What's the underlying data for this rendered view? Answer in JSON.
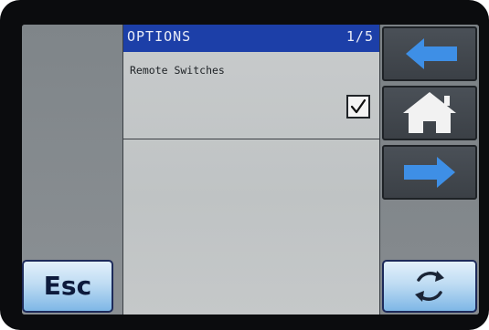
{
  "header": {
    "title": "OPTIONS",
    "page_indicator": "1/5"
  },
  "options": [
    {
      "label": "Remote Switches",
      "checked": true
    }
  ],
  "buttons": {
    "back": {
      "icon": "left-arrow-icon"
    },
    "home": {
      "icon": "home-icon"
    },
    "forward": {
      "icon": "right-arrow-icon"
    },
    "esc": {
      "label": "Esc"
    },
    "refresh": {
      "icon": "refresh-icon"
    }
  },
  "colors": {
    "title_bar": "#1c3fa8",
    "arrow": "#3e8fe6",
    "button_face": "#bfdcf3"
  }
}
